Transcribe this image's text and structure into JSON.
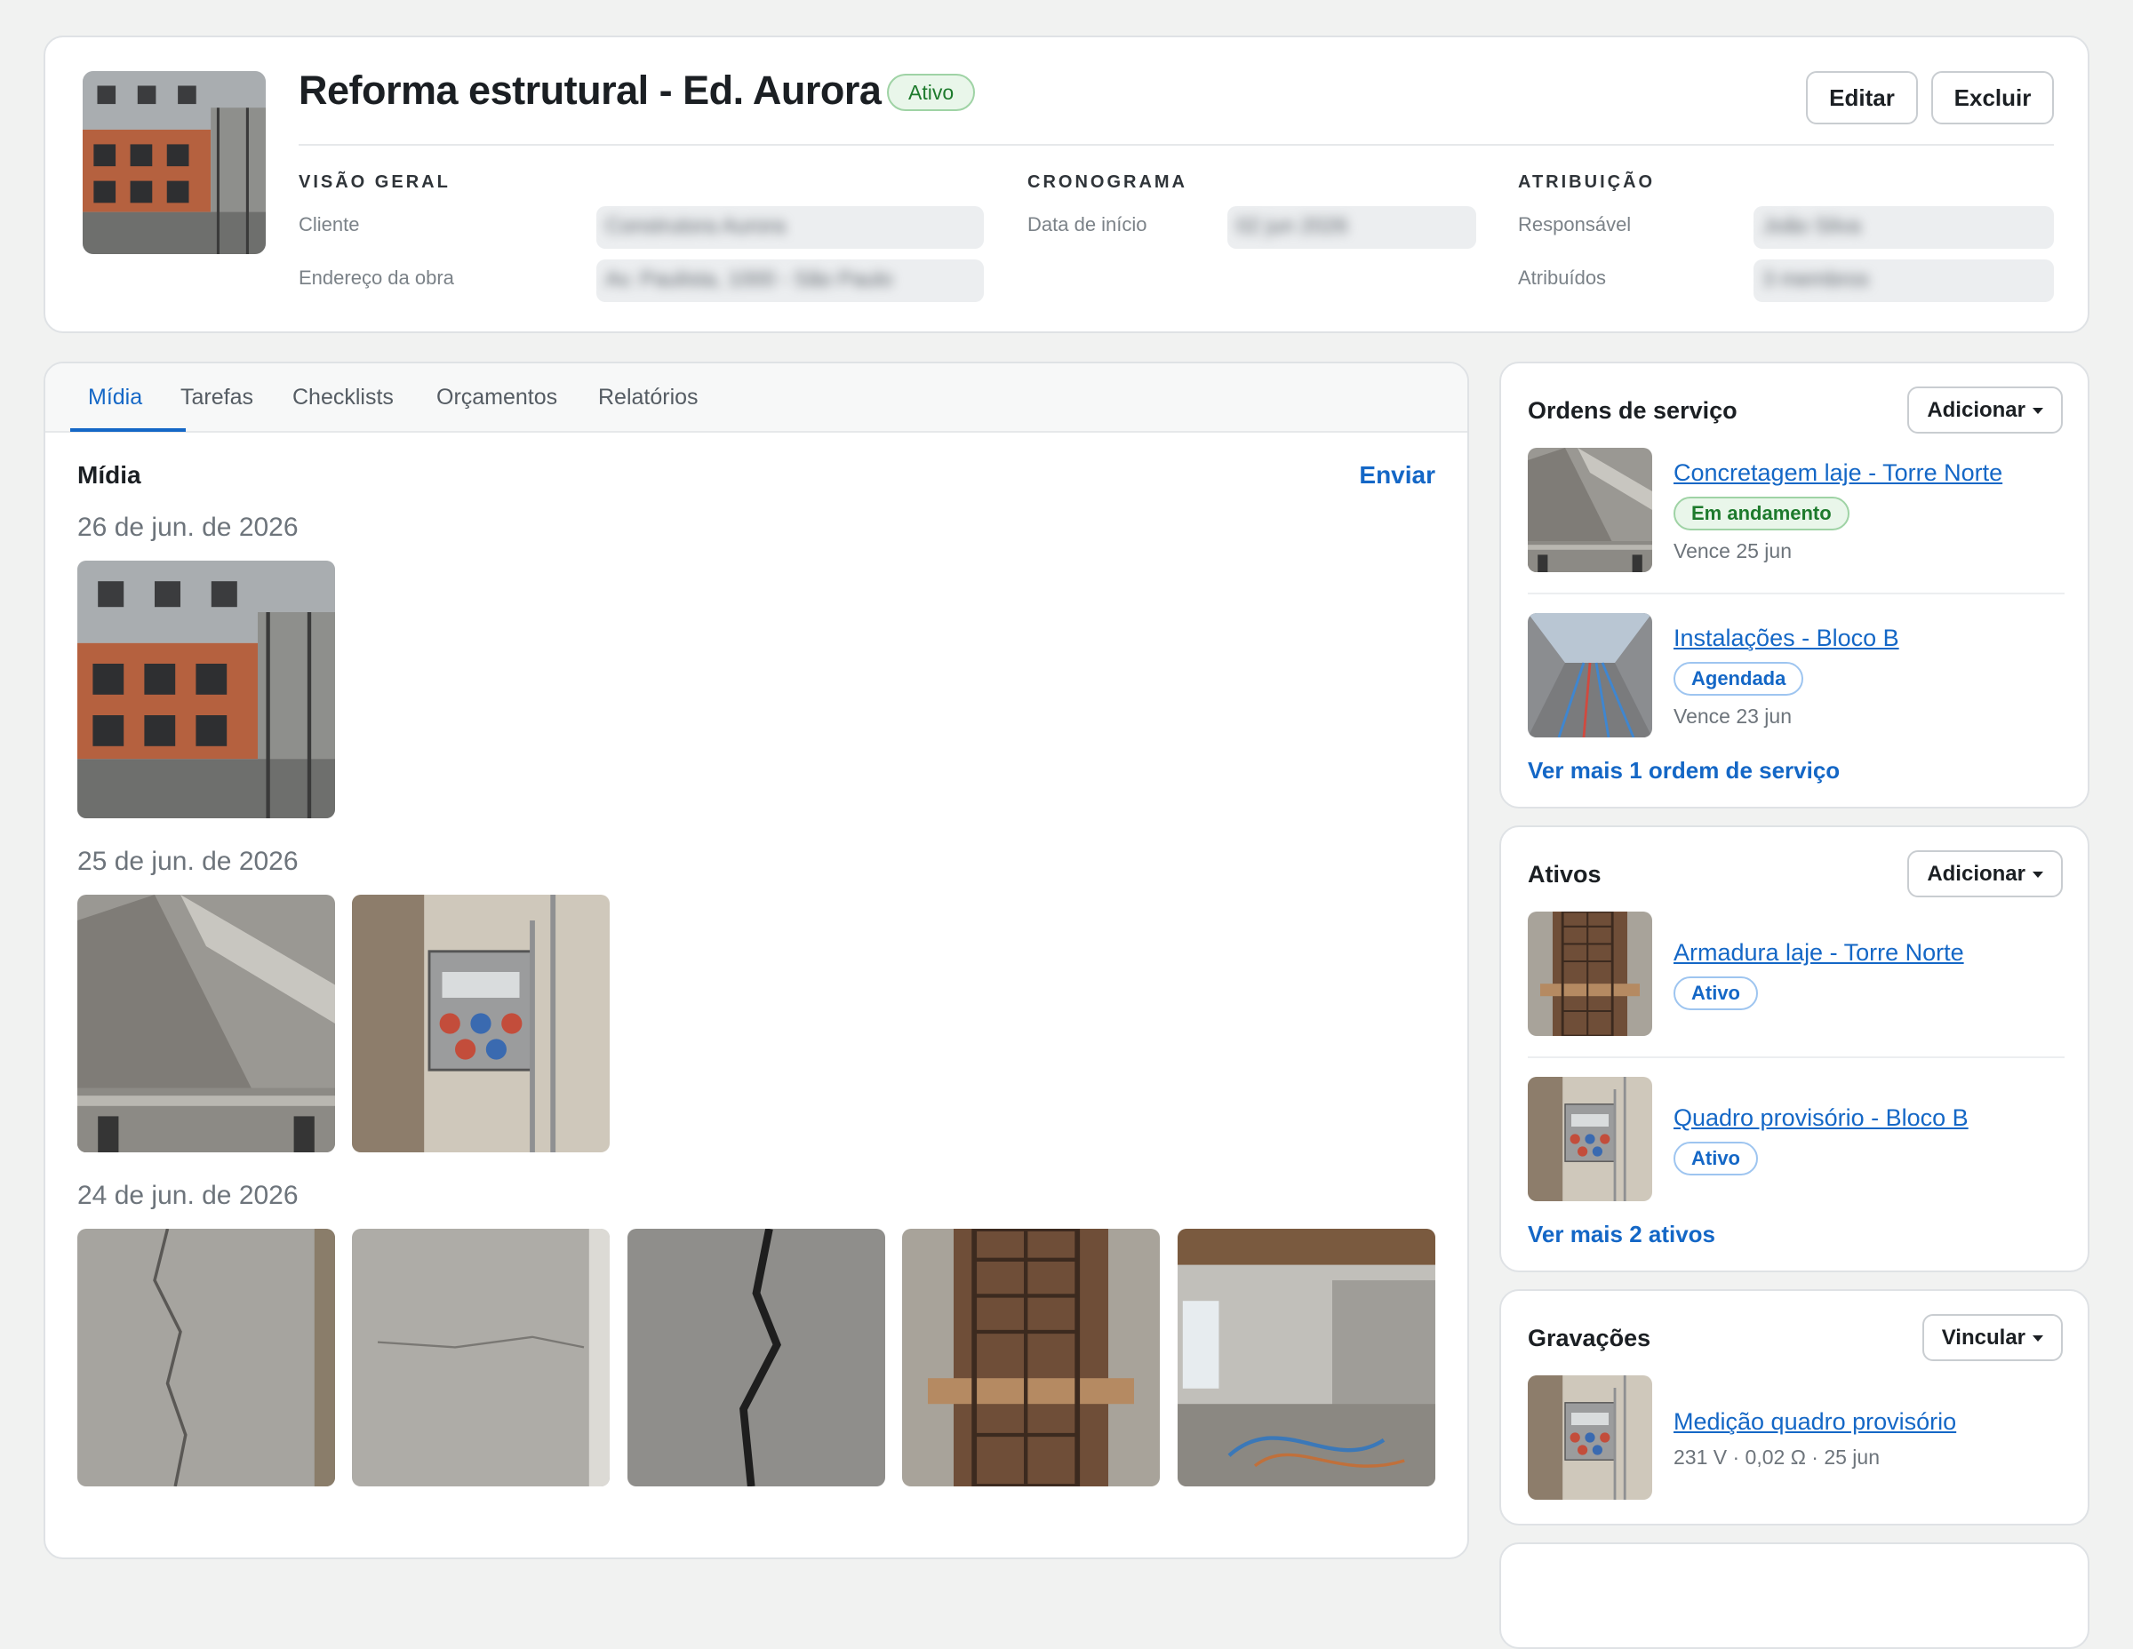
{
  "project": {
    "title": "Reforma estrutural - Ed. Aurora",
    "status": "Ativo",
    "edit_label": "Editar",
    "delete_label": "Excluir"
  },
  "overview": {
    "heading": "VISÃO GERAL",
    "client_label": "Cliente",
    "client_value": "Construtora Aurora",
    "address_label": "Endereço da obra",
    "address_value": "Av. Paulista, 1000 - São Paulo"
  },
  "schedule": {
    "heading": "CRONOGRAMA",
    "start_label": "Data de início",
    "start_value": "02 jun 2026"
  },
  "assignment": {
    "heading": "ATRIBUIÇÃO",
    "owner_label": "Responsável",
    "owner_value": "João Silva",
    "assignees_label": "Atribuídos",
    "assignees_value": "3 membros"
  },
  "tabs": [
    {
      "label": "Mídia"
    },
    {
      "label": "Tarefas"
    },
    {
      "label": "Checklists"
    },
    {
      "label": "Orçamentos"
    },
    {
      "label": "Relatórios"
    }
  ],
  "media": {
    "title": "Mídia",
    "send_label": "Enviar",
    "groups": [
      {
        "date": "26 de jun. de 2026"
      },
      {
        "date": "25 de jun. de 2026"
      },
      {
        "date": "24 de jun. de 2026"
      }
    ]
  },
  "service_orders": {
    "title": "Ordens de serviço",
    "add_label": "Adicionar",
    "items": [
      {
        "name": "Concretagem laje - Torre Norte",
        "status": "Em andamento",
        "due": "Vence 25 jun"
      },
      {
        "name": "Instalações - Bloco B",
        "status": "Agendada",
        "due": "Vence 23 jun"
      }
    ],
    "more_label": "Ver mais 1 ordem de serviço"
  },
  "assets": {
    "title": "Ativos",
    "add_label": "Adicionar",
    "items": [
      {
        "name": "Armadura laje - Torre Norte",
        "status": "Ativo"
      },
      {
        "name": "Quadro provisório - Bloco B",
        "status": "Ativo"
      }
    ],
    "more_label": "Ver mais 2 ativos"
  },
  "recordings": {
    "title": "Gravações",
    "link_label": "Vincular",
    "items": [
      {
        "name": "Medição quadro provisório",
        "meta": "231 V · 0,02 Ω · 25 jun"
      }
    ]
  },
  "colors": {
    "accent": "#1467c6",
    "success": "#1d7a2c",
    "background": "#f1f2f1"
  }
}
